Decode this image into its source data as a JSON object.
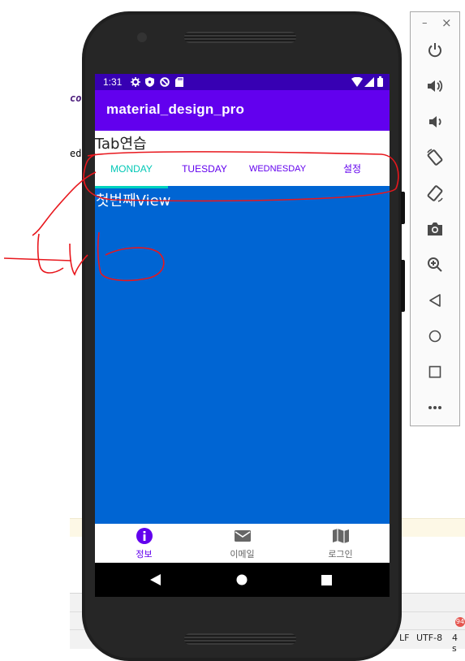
{
  "ide": {
    "frag_top": "co",
    "frag_mid": "ed",
    "status_lf": "LF",
    "status_encoding": "UTF-8",
    "status_indent": "4 s",
    "badge": "94"
  },
  "phone": {
    "status_time": "1:31",
    "app_title": "material_design_pro",
    "heading": "Tab연습",
    "tabs": [
      {
        "label": "MONDAY",
        "active": true
      },
      {
        "label": "TUESDAY",
        "active": false
      },
      {
        "label": "WEDNESDAY",
        "active": false
      },
      {
        "label": "설정",
        "active": false
      }
    ],
    "content_text": "첫번째View",
    "bottom_nav": [
      {
        "label": "정보",
        "icon": "info-icon",
        "active": true
      },
      {
        "label": "이메일",
        "icon": "mail-icon",
        "active": false
      },
      {
        "label": "로그인",
        "icon": "map-icon",
        "active": false
      }
    ],
    "system_nav": [
      "back-icon",
      "home-icon",
      "recents-icon"
    ]
  },
  "colors": {
    "status_bar": "#3700b3",
    "app_bar": "#6200ee",
    "tab_active": "#03c8b6",
    "tab_inactive": "#6200ee",
    "content_bg": "#0065d3",
    "annotation": "#e8171d"
  },
  "emulator_toolbar": {
    "minimize": "–",
    "close": "×",
    "buttons": [
      "power-icon",
      "volume-up-icon",
      "volume-down-icon",
      "rotate-left-icon",
      "rotate-right-icon",
      "camera-icon",
      "zoom-icon",
      "back-icon",
      "home-icon",
      "overview-icon",
      "more-icon"
    ]
  }
}
